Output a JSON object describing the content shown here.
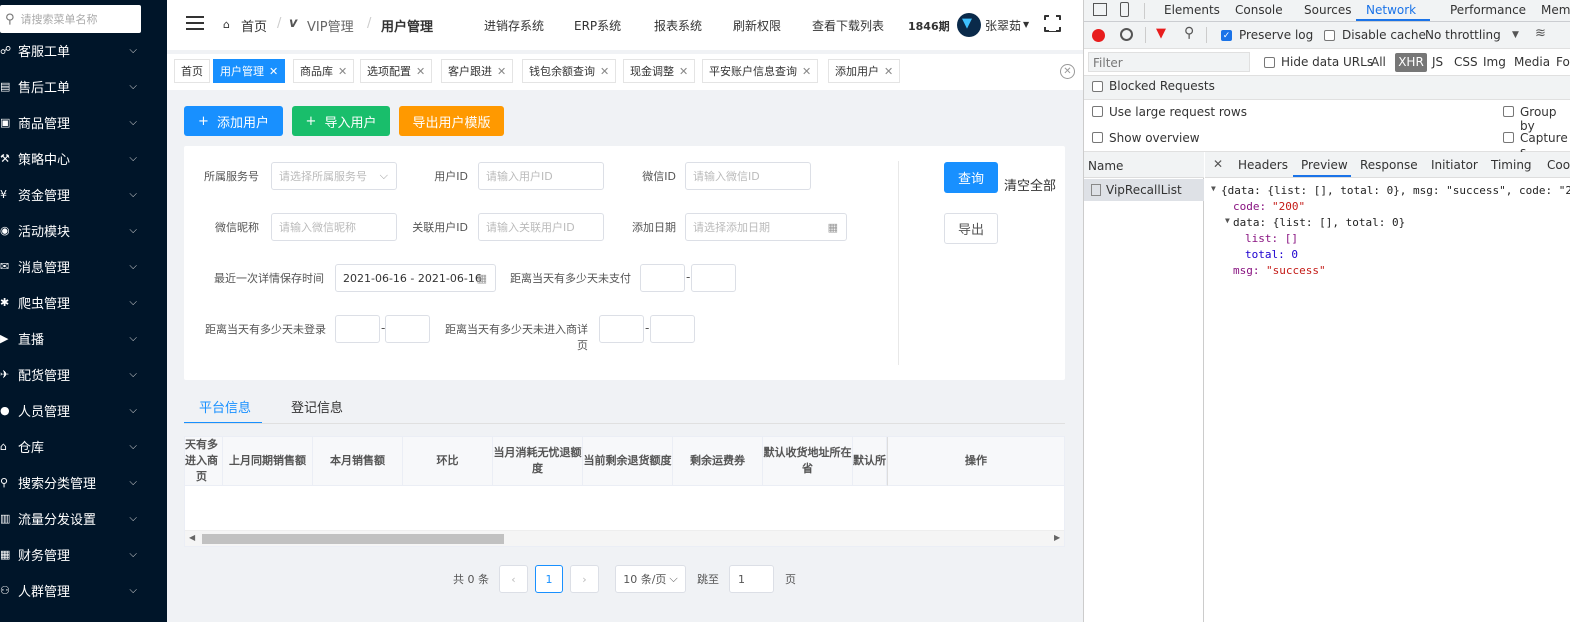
{
  "sidebar": {
    "search_placeholder": "请搜索菜单名称",
    "items": [
      {
        "label": "客服工单",
        "icon": "ticket-icon",
        "glyph": "☍"
      },
      {
        "label": "售后工单",
        "icon": "list-icon",
        "glyph": "▤"
      },
      {
        "label": "商品管理",
        "icon": "box-icon",
        "glyph": "▣"
      },
      {
        "label": "策略中心",
        "icon": "hammer-icon",
        "glyph": "⚒"
      },
      {
        "label": "资金管理",
        "icon": "yen-icon",
        "glyph": "¥"
      },
      {
        "label": "活动模块",
        "icon": "gamepad-icon",
        "glyph": "◉"
      },
      {
        "label": "消息管理",
        "icon": "message-icon",
        "glyph": "✉"
      },
      {
        "label": "爬虫管理",
        "icon": "bug-icon",
        "glyph": "✱"
      },
      {
        "label": "直播",
        "icon": "video-icon",
        "glyph": "▶"
      },
      {
        "label": "配货管理",
        "icon": "plane-icon",
        "glyph": "✈"
      },
      {
        "label": "人员管理",
        "icon": "user-icon",
        "glyph": "●"
      },
      {
        "label": "仓库",
        "icon": "warehouse-icon",
        "glyph": "⌂"
      },
      {
        "label": "搜索分类管理",
        "icon": "search-icon",
        "glyph": "⚲"
      },
      {
        "label": "流量分发设置",
        "icon": "chart-icon",
        "glyph": "▥"
      },
      {
        "label": "财务管理",
        "icon": "finance-icon",
        "glyph": "▦"
      },
      {
        "label": "人群管理",
        "icon": "group-icon",
        "glyph": "⚇"
      },
      {
        "label": "...",
        "icon": "more-icon",
        "glyph": "▪"
      }
    ]
  },
  "topbar": {
    "crumbs": [
      "首页",
      "VIP管理",
      "用户管理"
    ],
    "nav": [
      "进销存系统",
      "ERP系统",
      "报表系统",
      "刷新权限",
      "查看下载列表"
    ],
    "period": "1846期",
    "user": "张翠茹"
  },
  "tabs": [
    {
      "label": "首页",
      "closable": false,
      "active": false
    },
    {
      "label": "用户管理",
      "closable": true,
      "active": true
    },
    {
      "label": "商品库",
      "closable": true,
      "active": false
    },
    {
      "label": "选项配置",
      "closable": true,
      "active": false
    },
    {
      "label": "客户跟进",
      "closable": true,
      "active": false
    },
    {
      "label": "钱包余额查询",
      "closable": true,
      "active": false
    },
    {
      "label": "现金调整",
      "closable": true,
      "active": false
    },
    {
      "label": "平安账户信息查询",
      "closable": true,
      "active": false
    },
    {
      "label": "添加用户",
      "closable": true,
      "active": false
    }
  ],
  "actions": {
    "add_user": "添加用户",
    "import_user": "导入用户",
    "export_template": "导出用户模版"
  },
  "filters": {
    "service_no": {
      "label": "所属服务号",
      "placeholder": "请选择所属服务号"
    },
    "user_id": {
      "label": "用户ID",
      "placeholder": "请输入用户ID"
    },
    "wechat_id": {
      "label": "微信ID",
      "placeholder": "请输入微信ID"
    },
    "wechat_nick": {
      "label": "微信昵称",
      "placeholder": "请输入微信昵称"
    },
    "linked_user_id": {
      "label": "关联用户ID",
      "placeholder": "请输入关联用户ID"
    },
    "add_date": {
      "label": "添加日期",
      "placeholder": "请选择添加日期"
    },
    "last_detail_save": {
      "label": "最近一次详情保存时间",
      "value": "2021-06-16 - 2021-06-16"
    },
    "days_unpaid": {
      "label": "距离当天有多少天未支付"
    },
    "days_no_login": {
      "label": "距离当天有多少天未登录"
    },
    "days_no_detail": {
      "label": "距离当天有多少天未进入商详页"
    },
    "query": "查询",
    "clear_all": "清空全部",
    "export": "导出"
  },
  "subtabs": [
    "平台信息",
    "登记信息"
  ],
  "table": {
    "columns": [
      "天有多进入商页",
      "上月同期销售额",
      "本月销售额",
      "环比",
      "当月消耗无忧退额度",
      "当前剩余退货额度",
      "剩余运费券",
      "默认收货地址所在省",
      "默认所",
      "操作"
    ]
  },
  "pagination": {
    "total": "共 0 条",
    "current": "1",
    "page_size": "10 条/页",
    "goto": "跳至",
    "goto_value": "1",
    "page_unit": "页"
  },
  "devtools": {
    "tabs": [
      "Elements",
      "Console",
      "Sources",
      "Network",
      "Performance",
      "Memory"
    ],
    "active_tab": "Network",
    "preserve_log": "Preserve log",
    "disable_cache": "Disable cache",
    "throttling": "No throttling",
    "filter_placeholder": "Filter",
    "hide_data_urls": "Hide data URLs",
    "types": [
      "All",
      "XHR",
      "JS",
      "CSS",
      "Img",
      "Media",
      "Fo"
    ],
    "blocked_requests": "Blocked Requests",
    "large_rows": "Use large request rows",
    "group_by": "Group by",
    "show_overview": "Show overview",
    "capture": "Capture s",
    "name_header": "Name",
    "request_name": "VipRecallList",
    "detail_tabs": [
      "Headers",
      "Preview",
      "Response",
      "Initiator",
      "Timing",
      "Coo"
    ],
    "preview_lines": [
      "{data: {list: [], total: 0}, msg: \"success\", code: \"2",
      "code: \"200\"",
      "data: {list: [], total: 0}",
      "list: []",
      "total: 0",
      "msg: \"success\""
    ]
  }
}
